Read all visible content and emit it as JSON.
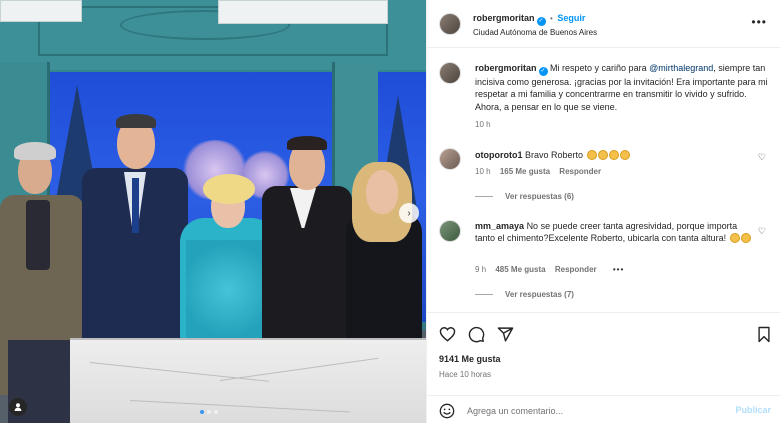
{
  "post": {
    "photo": {
      "carousel_dots": 3,
      "active_dot": 0
    },
    "header": {
      "username": "robergmoritan",
      "follow_label": "Seguir",
      "location": "Ciudad Autónoma de Buenos Aires",
      "separator": "•"
    },
    "caption": {
      "username": "robergmoritan",
      "text_before": "Mi respeto y cariño para ",
      "mention": "@mirthalegrand",
      "text_after": ", siempre tan incisiva como generosa. ¡gracias por la invitación! Era importante para mi respetar a mi familia y concentrarme en transmitir lo vivido y sufrido. Ahora, a pensar en lo que se viene.",
      "time": "10 h"
    },
    "comments": [
      {
        "username": "otoporoto1",
        "text": "Bravo Roberto",
        "clap_count": 4,
        "time": "10 h",
        "likes": "165 Me gusta",
        "reply_label": "Responder",
        "view_replies": "Ver respuestas (6)"
      },
      {
        "username": "mm_amaya",
        "text": "No se puede creer tanta agresividad, porque importa tanto el chimento?Excelente Roberto, ubicarla con tanta altura!",
        "clap_count": 2,
        "time": "9 h",
        "likes": "485 Me gusta",
        "reply_label": "Responder",
        "view_replies": "Ver respuestas (7)"
      }
    ],
    "actions": {
      "like_count": "9141 Me gusta",
      "time_ago": "Hace 10 horas"
    },
    "add_comment": {
      "placeholder": "Agrega un comentario...",
      "publish_label": "Publicar"
    }
  },
  "colors": {
    "accent_blue": "#0095f6",
    "mention_blue": "#00376b",
    "muted_text": "#737373"
  },
  "icons": [
    "verified-badge-icon",
    "more-options-icon",
    "heart-icon",
    "comment-icon",
    "share-icon",
    "bookmark-icon",
    "emoji-icon",
    "chevron-right-icon",
    "user-tag-icon",
    "clap-emoji-icon"
  ]
}
